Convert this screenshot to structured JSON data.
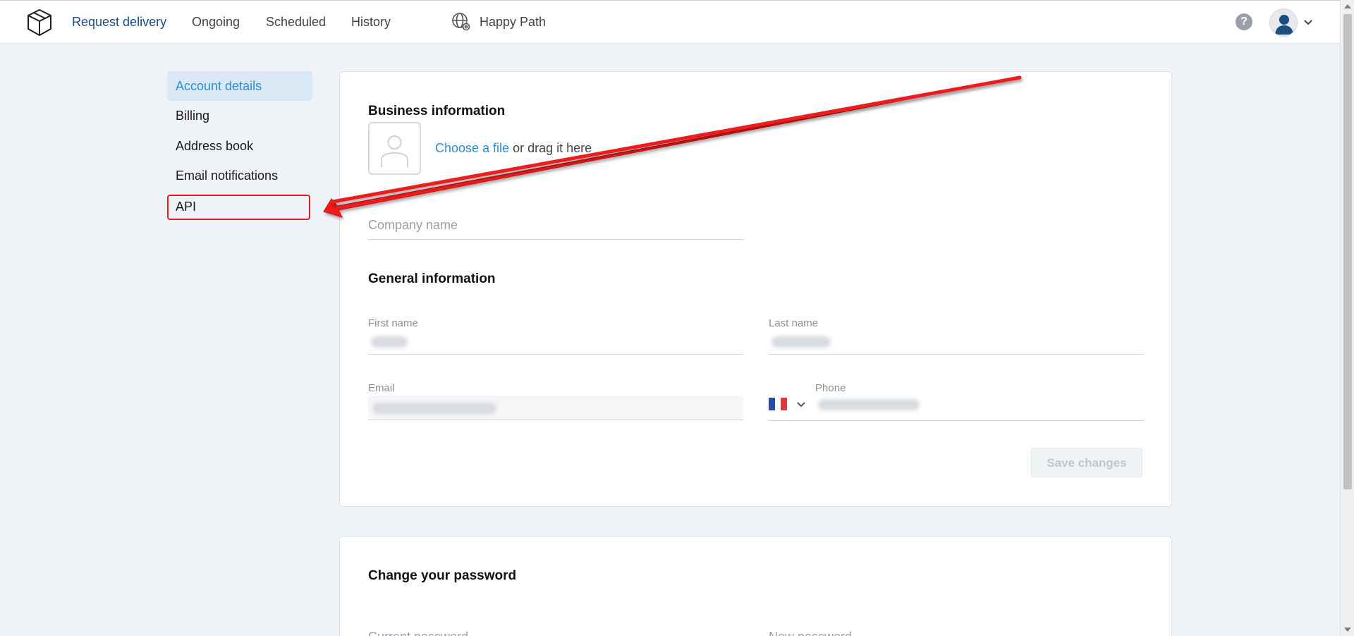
{
  "topbar": {
    "nav": [
      {
        "label": "Request delivery"
      },
      {
        "label": "Ongoing"
      },
      {
        "label": "Scheduled"
      },
      {
        "label": "History"
      }
    ],
    "workspace_label": "Happy Path",
    "help_label": "?"
  },
  "sidebar": {
    "items": [
      {
        "label": "Account details"
      },
      {
        "label": "Billing"
      },
      {
        "label": "Address book"
      },
      {
        "label": "Email notifications"
      },
      {
        "label": "API"
      }
    ]
  },
  "business": {
    "title": "Business information",
    "upload_link": "Choose a file",
    "upload_suffix": " or drag it here",
    "company_placeholder": "Company name"
  },
  "general": {
    "title": "General information",
    "first_name_label": "First name",
    "last_name_label": "Last name",
    "email_label": "Email",
    "phone_label": "Phone",
    "save_label": "Save changes"
  },
  "password": {
    "title": "Change your password",
    "current_label": "Current password",
    "new_label": "New password"
  },
  "colors": {
    "accent": "#2b8fd6",
    "nav_active": "#1a4d80",
    "annotation": "#e02020",
    "background": "#eff3f7"
  }
}
